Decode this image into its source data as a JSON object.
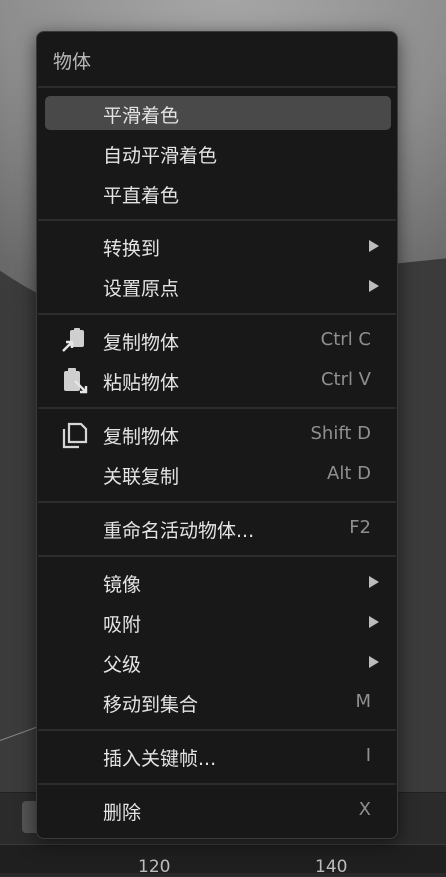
{
  "menu": {
    "title": "物体",
    "items": [
      {
        "label": "平滑着色"
      },
      {
        "label": "自动平滑着色"
      },
      {
        "label": "平直着色"
      },
      {
        "label": "转换到"
      },
      {
        "label": "设置原点"
      },
      {
        "label": "复制物体",
        "shortcut": "Ctrl C",
        "icon": "copy-to-clipboard-icon"
      },
      {
        "label": "粘贴物体",
        "shortcut": "Ctrl V",
        "icon": "paste-from-clipboard-icon"
      },
      {
        "label": "复制物体",
        "shortcut": "Shift D",
        "icon": "duplicate-icon"
      },
      {
        "label": "关联复制",
        "shortcut": "Alt D"
      },
      {
        "label": "重命名活动物体...",
        "shortcut": "F2"
      },
      {
        "label": "镜像"
      },
      {
        "label": "吸附"
      },
      {
        "label": "父级"
      },
      {
        "label": "移动到集合",
        "shortcut": "M"
      },
      {
        "label": "插入关键帧...",
        "shortcut": "I"
      },
      {
        "label": "删除",
        "shortcut": "X"
      }
    ]
  },
  "timeline": {
    "ruler_labels": [
      "120",
      "140"
    ]
  },
  "colors": {
    "menu_bg": "#181818",
    "highlight_bg": "#494949",
    "text": "#e4e4e4",
    "shortcut_text": "#8f8f8f"
  }
}
